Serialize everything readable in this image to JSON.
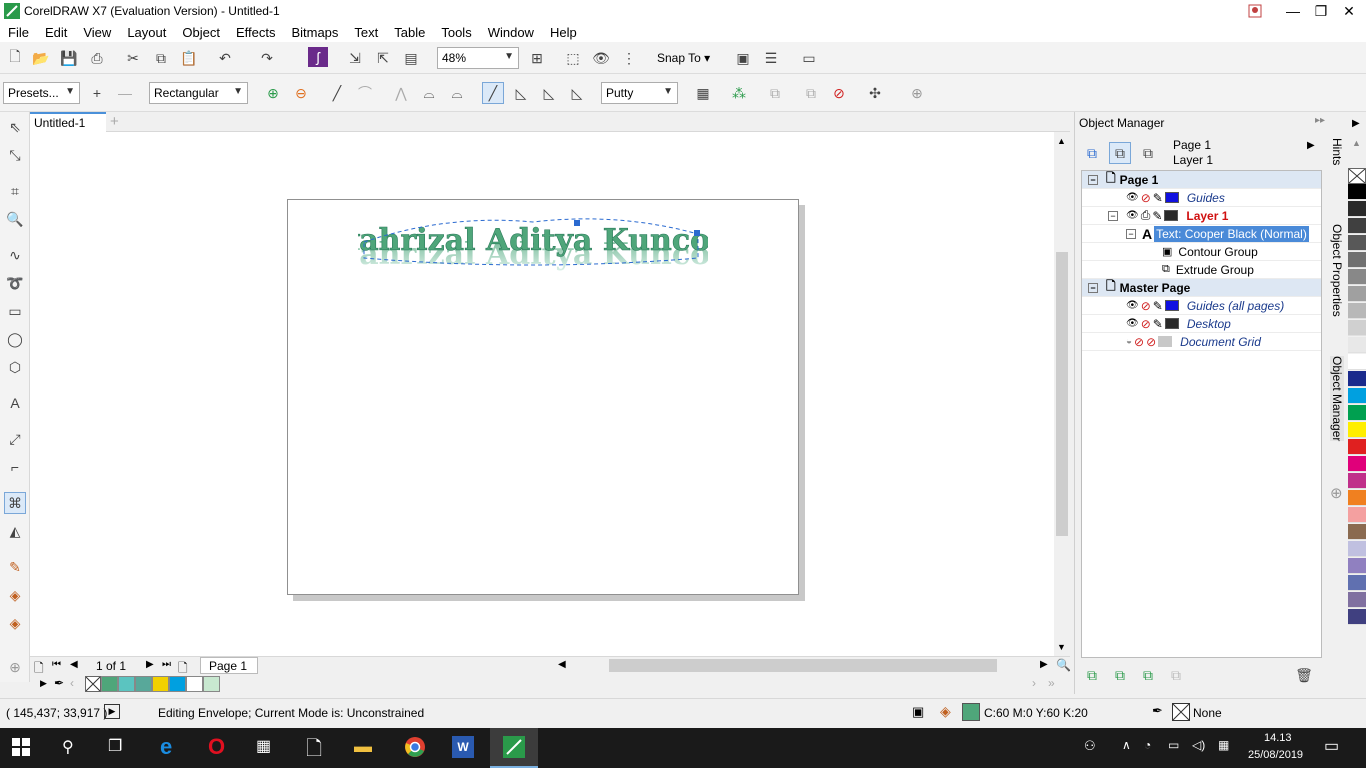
{
  "window": {
    "title": "CorelDRAW X7 (Evaluation Version) - Untitled-1"
  },
  "menu": [
    "File",
    "Edit",
    "View",
    "Layout",
    "Object",
    "Effects",
    "Bitmaps",
    "Text",
    "Table",
    "Tools",
    "Window",
    "Help"
  ],
  "toolbar": {
    "zoom": "48%",
    "snap": "Snap To"
  },
  "propbar": {
    "presets": "Presets...",
    "mode": "Rectangular",
    "mapping": "Putty"
  },
  "doc": {
    "tab": "Untitled-1",
    "art_text": "Syahrizal Aditya Kuncoro"
  },
  "pager": {
    "count": "1 of 1",
    "page_tab": "Page 1"
  },
  "status": {
    "coords": "( 145,437; 33,917 )",
    "message": "Editing Envelope;  Current Mode is: Unconstrained",
    "fill": "C:60 M:0 Y:60 K:20",
    "outline": "None"
  },
  "object_manager": {
    "title": "Object Manager",
    "page": "Page 1",
    "layer": "Layer 1",
    "rows": [
      {
        "label": "Page 1",
        "type": "header"
      },
      {
        "label": "Guides",
        "type": "layer",
        "color": "#1010e0"
      },
      {
        "label": "Layer 1",
        "type": "active",
        "color": "#2a2a2a"
      },
      {
        "label": "Text: Cooper Black (Normal)",
        "type": "selected"
      },
      {
        "label": "Contour Group",
        "type": "child"
      },
      {
        "label": "Extrude Group",
        "type": "child"
      },
      {
        "label": "Master Page",
        "type": "header"
      },
      {
        "label": "Guides (all pages)",
        "type": "layer",
        "color": "#1010e0"
      },
      {
        "label": "Desktop",
        "type": "layer",
        "color": "#2a2a2a"
      },
      {
        "label": "Document Grid",
        "type": "layer",
        "color": "#c8c8c8"
      }
    ]
  },
  "dock_tabs": [
    "Hints",
    "Object Properties",
    "Object Manager"
  ],
  "taskbar": {
    "time": "14.13",
    "date": "25/08/2019"
  },
  "colors": {
    "accent": "#4fa67a",
    "palette": [
      "#000000",
      "#2a2a2a",
      "#404040",
      "#585858",
      "#707070",
      "#888888",
      "#a0a0a0",
      "#b8b8b8",
      "#d0d0d0",
      "#e8e8e8",
      "#ffffff",
      "#1a2a8c",
      "#00a0e0",
      "#00a050",
      "#ffee00",
      "#e02020",
      "#e0007a",
      "#c0308a",
      "#f08020",
      "#f4a0a0",
      "#8a6a50",
      "#c0c0e0",
      "#9080c0",
      "#6070b0",
      "#8070a0",
      "#404080"
    ],
    "doc_swatches": [
      "#4fa67a",
      "#5bc4c0",
      "#58a89a",
      "#f2d000",
      "#00a0e0",
      "#ffffff",
      "#c8e8d0"
    ]
  }
}
